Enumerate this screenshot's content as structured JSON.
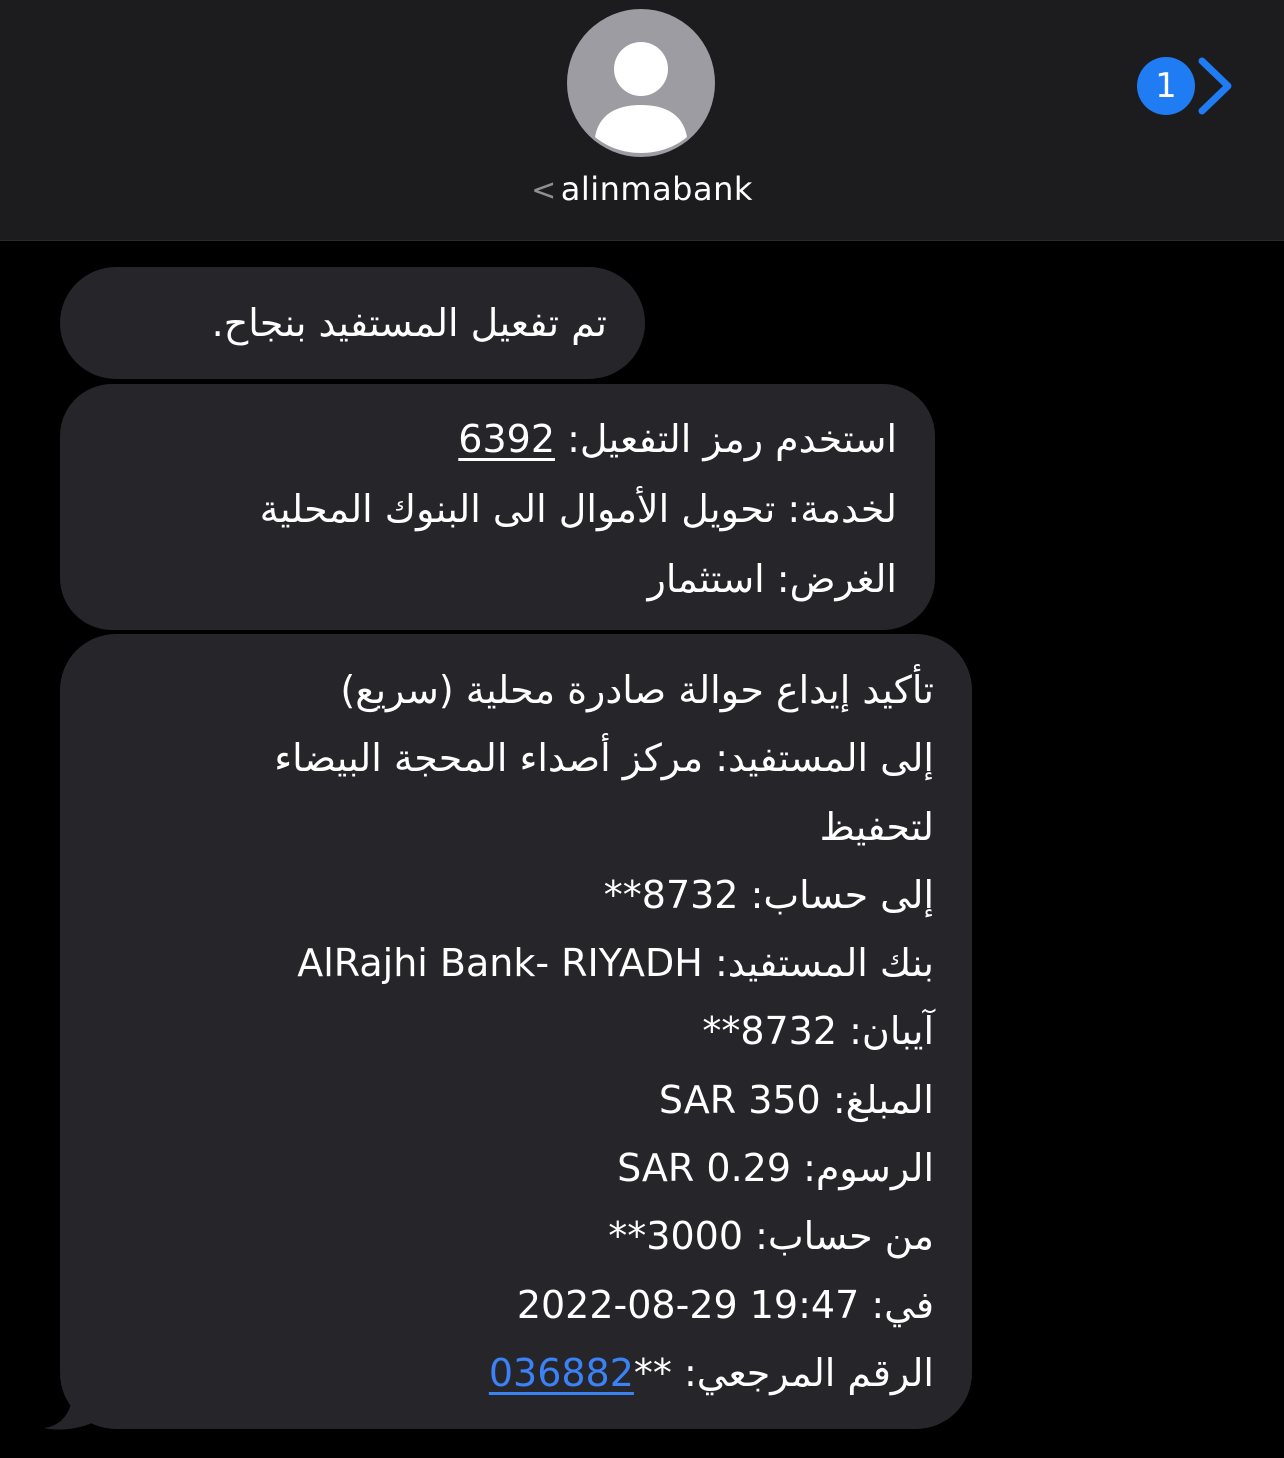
{
  "header": {
    "contact_name": "alinmabank",
    "back_chevron": "<",
    "unread_count": "1",
    "avatar_icon": "person-icon",
    "forward_icon": "chevron-right-icon"
  },
  "colors": {
    "header_bg": "#1c1c1e",
    "bubble_bg": "#26262a",
    "accent_blue": "#1f7cf2",
    "link_blue": "#3b82f6",
    "background": "#000000"
  },
  "messages": {
    "m1": {
      "text": "تم تفعيل المستفيد بنجاح."
    },
    "m2": {
      "line1_label": "استخدم رمز التفعيل: ",
      "code": "6392",
      "line2": "لخدمة: تحويل الأموال الى البنوك المحلية",
      "line3": "الغرض: استثمار"
    },
    "m3": {
      "line1": "تأكيد إيداع حوالة صادرة محلية (سريع)",
      "line2": "إلى المستفيد: مركز أصداء المحجة البيضاء",
      "line3": "لتحفيظ",
      "to_account_label": "إلى حساب: ",
      "to_account_value": "**8732",
      "bank_label": "بنك المستفيد: ",
      "bank_value": "AlRajhi Bank- RIYADH",
      "iban_label": "آيبان: ",
      "iban_value": "**8732",
      "amount_label": "المبلغ: ",
      "amount_value": "SAR 350",
      "fees_label": "الرسوم: ",
      "fees_value": "SAR 0.29",
      "from_account_label": "من حساب: ",
      "from_account_value": "**3000",
      "date_label": "في: ",
      "date_value": "2022-08-29 19:47",
      "ref_label": "الرقم المرجعي: ",
      "ref_prefix": "**",
      "ref_link": "036882"
    }
  }
}
